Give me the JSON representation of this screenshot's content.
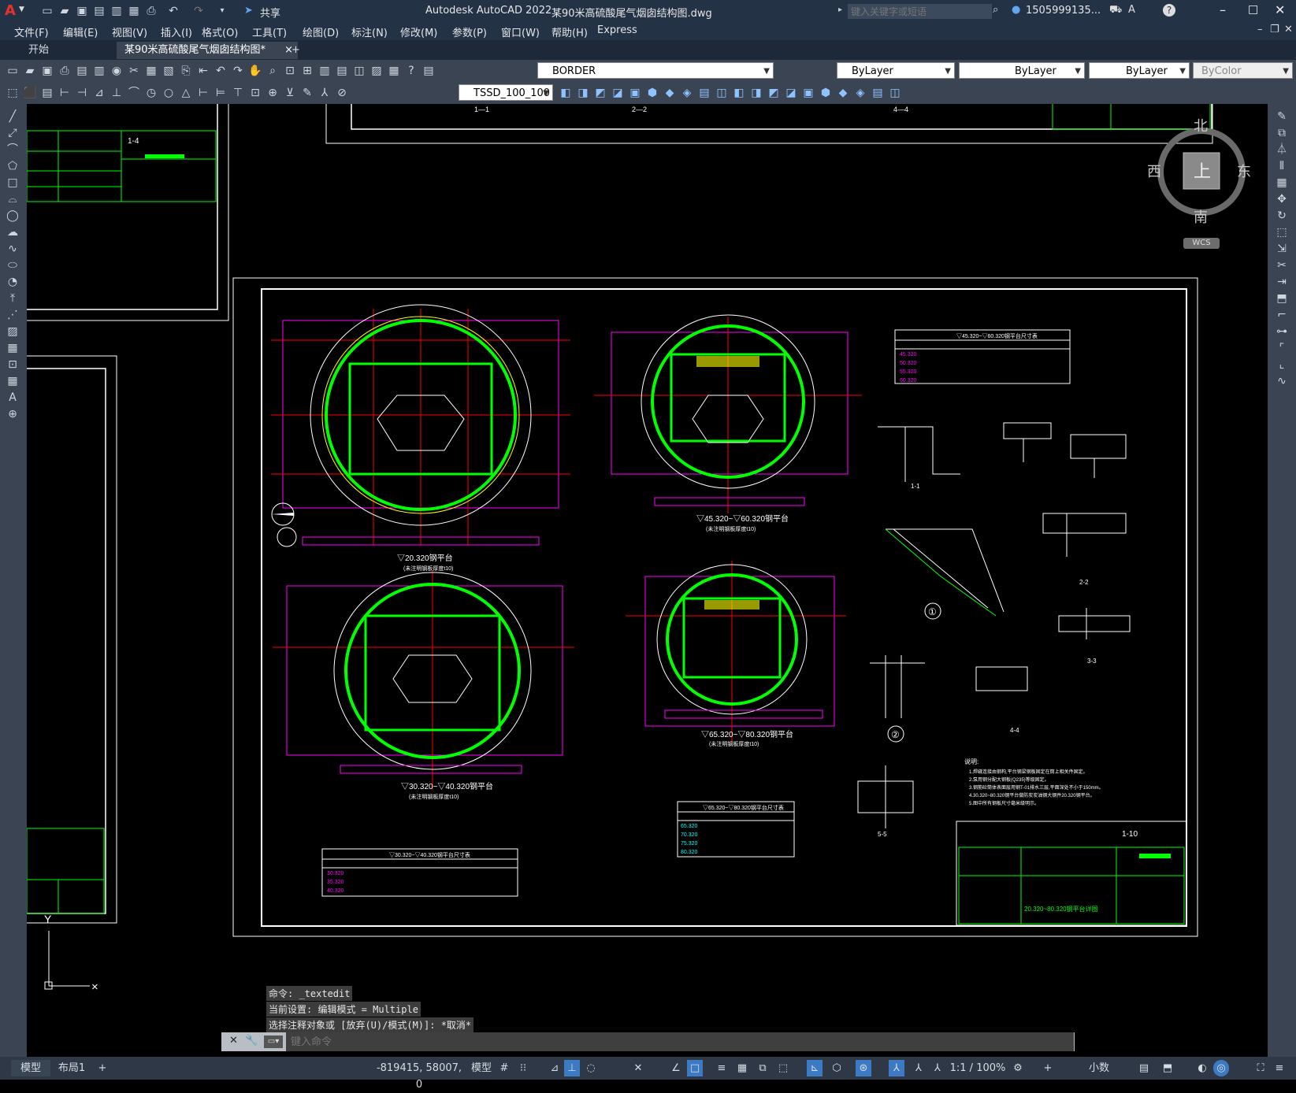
{
  "app": {
    "title": "Autodesk AutoCAD 2022",
    "file": "某90米高硫酸尾气烟囱结构图.dwg",
    "share_label": "共享",
    "search_placeholder": "键入关键字或短语",
    "user": "1505999135...",
    "brand_color": "#e8312f",
    "accent_color": "#2a7fd4"
  },
  "menu": [
    "文件(F)",
    "编辑(E)",
    "视图(V)",
    "插入(I)",
    "格式(O)",
    "工具(T)",
    "绘图(D)",
    "标注(N)",
    "修改(M)",
    "参数(P)",
    "窗口(W)",
    "帮助(H)",
    "Express"
  ],
  "tabs": {
    "start": "开始",
    "active": "某90米高硫酸尾气烟囱结构图*",
    "close": "×",
    "add": "+"
  },
  "toolbar": {
    "layer": "BORDER",
    "color": "ByLayer",
    "linetype": "ByLayer",
    "lineweight": "ByLayer",
    "plotstyle": "ByColor",
    "dimstyle": "TSSD_100_100"
  },
  "viewcube": {
    "top": "上",
    "west": "西",
    "east": "东",
    "south": "南",
    "north": "北",
    "wcs": "WCS"
  },
  "drawing": {
    "sheet_no": "1-10",
    "top_sheet_no": "1-4",
    "title_green": "20.320~80.320钢平台详图",
    "plan_titles": [
      "▽20.320钢平台",
      "▽45.320~▽60.320钢平台",
      "▽30.320~▽40.320钢平台",
      "▽65.320~▽80.320钢平台"
    ],
    "plan_subtitles": [
      "(未注明钢板厚度t10)",
      "(未注明钢板厚度t10)",
      "(未注明钢板厚度t10)",
      "(未注明钢板厚度t10)"
    ],
    "table1": {
      "title": "▽45.320~▽60.320钢平台尺寸表",
      "rows": [
        "45.320",
        "50.320",
        "55.320",
        "60.320"
      ]
    },
    "table2": {
      "title": "▽65.320~▽80.320钢平台尺寸表",
      "rows": [
        "65.320",
        "70.320",
        "75.320",
        "80.320"
      ]
    },
    "table3": {
      "title": "▽30.320~▽40.320钢平台尺寸表",
      "rows": [
        "30.320",
        "35.320",
        "40.320"
      ]
    },
    "sections": [
      "1-1",
      "2-2",
      "3-3",
      "4-4",
      "5-5",
      "1-1",
      "2-2",
      "4-4"
    ],
    "detail_marks": [
      "①",
      "②"
    ],
    "notes_title": "说明:",
    "notes": [
      "1.焊缝连接由钢构,平台钢梁钢板固定在筒上相关件固定。",
      "2.泵用钢分配大钢板(Q235)等级固定。",
      "3.钢筋砼筒体表面层用钢T-01排水三层,平面深处不小于150mm。",
      "4.30.320~80.320钢平台做防炭炭油钢大钢件20.320钢平台。",
      "5.图中所有钢板尺寸毫米级明示。"
    ]
  },
  "ucs": {
    "y": "Y"
  },
  "command": {
    "history": [
      "命令: _textedit",
      "当前设置: 编辑模式 = Multiple",
      "选择注释对象或 [放弃(U)/模式(M)]: *取消*"
    ],
    "placeholder": "键入命令"
  },
  "status": {
    "model_tab": "模型",
    "layout_tab": "布局1",
    "coords": "-819415, 58007, 0",
    "model": "模型",
    "scale": "1:1 / 100%",
    "units": "小数"
  }
}
